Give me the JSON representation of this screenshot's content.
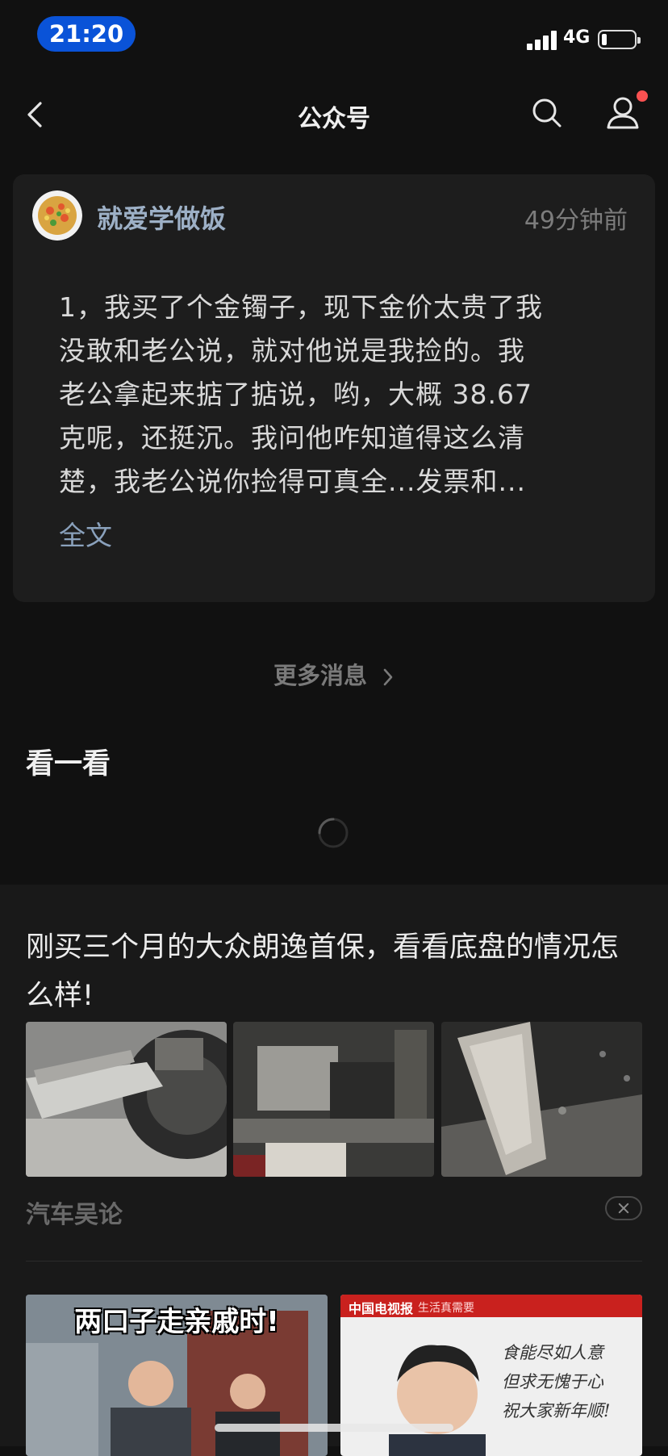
{
  "status_bar": {
    "time": "21:20",
    "network": "4G",
    "battery_level": 0.15
  },
  "nav": {
    "title": "公众号",
    "icons": [
      "back-arrow-icon",
      "search-icon",
      "profile-icon"
    ],
    "has_notification_dot": true
  },
  "message": {
    "account_name": "就爱学做饭",
    "time": "49分钟前",
    "lines": [
      "1，我买了个金镯子，现下金价太贵了我",
      "没敢和老公说，就对他说是我捡的。我",
      "老公拿起来掂了掂说，哟，大概 38.67",
      "克呢，还挺沉。我问他咋知道得这么清",
      "楚，我老公说你捡得可真全...发票和..."
    ],
    "full_text_link": "全文"
  },
  "more_messages": "更多消息",
  "section": {
    "title": "看一看"
  },
  "feed": {
    "article": {
      "title": "刚买三个月的大众朗逸首保，看看底盘的情况怎么样!",
      "source": "汽车吴论",
      "thumbnail_count": 3
    },
    "videos": [
      {
        "caption": "两口子走亲戚时!"
      },
      {
        "brand": "中国电视报",
        "tag": "生活真需要",
        "script_lines": [
          "食能尽如人意",
          "但求无愧于心",
          "祝大家新年顺!"
        ]
      }
    ]
  },
  "colors": {
    "background": "#111111",
    "card": "#1d1d1d",
    "link": "#8aa1bc",
    "accent_badge": "#fa5151",
    "time_pill": "#0a53d8"
  }
}
